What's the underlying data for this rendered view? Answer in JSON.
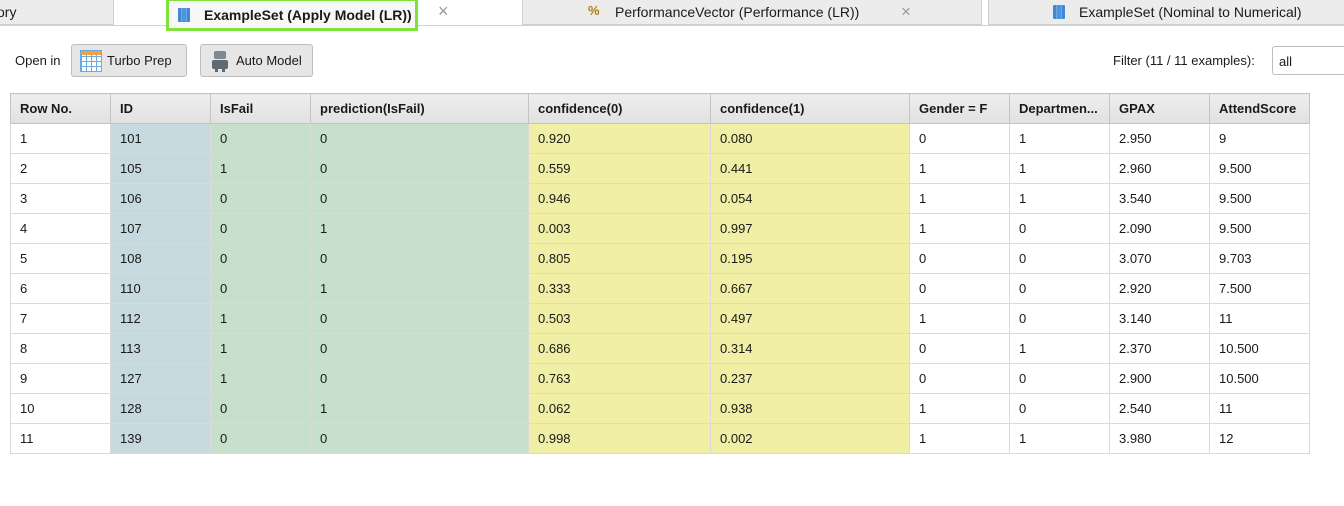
{
  "tabs": [
    {
      "label": "ory",
      "icon": "none",
      "closable": false
    },
    {
      "label": "ExampleSet (Apply Model (LR))",
      "icon": "table-icon",
      "closable": true,
      "active": true
    },
    {
      "label": "PerformanceVector (Performance (LR))",
      "icon": "performance-icon",
      "closable": true
    },
    {
      "label": "ExampleSet (Nominal to Numerical)",
      "icon": "table-icon",
      "closable": false
    }
  ],
  "close_glyph": "×",
  "perf_glyph": "%",
  "toolbar": {
    "open_in_label": "Open in",
    "turbo_prep_label": "Turbo Prep",
    "auto_model_label": "Auto Model",
    "filter_label": "Filter (11 / 11 examples):",
    "filter_value": "all"
  },
  "table": {
    "columns": [
      "Row No.",
      "ID",
      "IsFail",
      "prediction(IsFail)",
      "confidence(0)",
      "confidence(1)",
      "Gender = F",
      "Departmen...",
      "GPAX",
      "AttendScore"
    ],
    "rows": [
      [
        "1",
        "101",
        "0",
        "0",
        "0.920",
        "0.080",
        "0",
        "1",
        "2.950",
        "9"
      ],
      [
        "2",
        "105",
        "1",
        "0",
        "0.559",
        "0.441",
        "1",
        "1",
        "2.960",
        "9.500"
      ],
      [
        "3",
        "106",
        "0",
        "0",
        "0.946",
        "0.054",
        "1",
        "1",
        "3.540",
        "9.500"
      ],
      [
        "4",
        "107",
        "0",
        "1",
        "0.003",
        "0.997",
        "1",
        "0",
        "2.090",
        "9.500"
      ],
      [
        "5",
        "108",
        "0",
        "0",
        "0.805",
        "0.195",
        "0",
        "0",
        "3.070",
        "9.703"
      ],
      [
        "6",
        "110",
        "0",
        "1",
        "0.333",
        "0.667",
        "0",
        "0",
        "2.920",
        "7.500"
      ],
      [
        "7",
        "112",
        "1",
        "0",
        "0.503",
        "0.497",
        "1",
        "0",
        "3.140",
        "11"
      ],
      [
        "8",
        "113",
        "1",
        "0",
        "0.686",
        "0.314",
        "0",
        "1",
        "2.370",
        "10.500"
      ],
      [
        "9",
        "127",
        "1",
        "0",
        "0.763",
        "0.237",
        "0",
        "0",
        "2.900",
        "10.500"
      ],
      [
        "10",
        "128",
        "0",
        "1",
        "0.062",
        "0.938",
        "1",
        "0",
        "2.540",
        "11"
      ],
      [
        "11",
        "139",
        "0",
        "0",
        "0.998",
        "0.002",
        "1",
        "1",
        "3.980",
        "12"
      ]
    ]
  },
  "colors": {
    "active_tab_border": "#7fe23a",
    "id_column": "#c6d9df",
    "label_columns": "#c6e0cc",
    "confidence_columns": "#f0efa5"
  }
}
